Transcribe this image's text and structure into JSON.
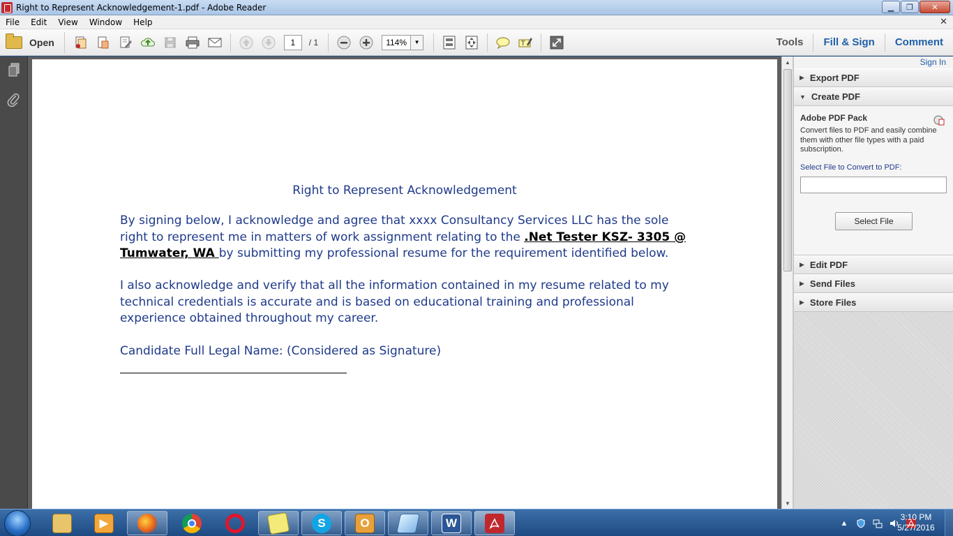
{
  "window": {
    "title": "Right to Represent Acknowledgement-1.pdf - Adobe Reader",
    "minimize": "▁",
    "maximize": "❐",
    "close": "✕"
  },
  "menu": {
    "items": [
      "File",
      "Edit",
      "View",
      "Window",
      "Help"
    ],
    "close_doc": "✕"
  },
  "toolbar": {
    "open_label": "Open",
    "page_current": "1",
    "page_total": "/ 1",
    "zoom": "114%",
    "tools": "Tools",
    "fill_sign": "Fill & Sign",
    "comment": "Comment"
  },
  "document": {
    "title": "Right to Represent Acknowledgement",
    "para1_a": "By signing below, I acknowledge and agree that xxxx Consultancy Services LLC has the sole right to represent me in matters of work assignment relating to the ",
    "para1_highlight": ".Net Tester KSZ- 3305 @ Tumwater, WA ",
    "para1_b": "by submitting my professional resume for the requirement identified below.",
    "para2": "I also acknowledge and verify that all the information contained in my resume related to my technical credentials is accurate and is based on educational training and professional experience obtained throughout my career.",
    "para3": "Candidate Full Legal Name: (Considered as Signature)"
  },
  "right_pane": {
    "sign_in": "Sign In",
    "export_pdf": "Export PDF",
    "create_pdf": "Create PDF",
    "pack_title": "Adobe PDF Pack",
    "pack_desc": "Convert files to PDF and easily combine them with other file types with a paid subscription.",
    "select_label": "Select File to Convert to PDF:",
    "select_button": "Select File",
    "edit_pdf": "Edit PDF",
    "send_files": "Send Files",
    "store_files": "Store Files"
  },
  "taskbar": {
    "time": "3:10 PM",
    "date": "5/27/2016"
  },
  "colors": {
    "doc_text": "#1f3a8a",
    "link_blue": "#1f5fa8",
    "taskbar": "#1e4a82"
  }
}
